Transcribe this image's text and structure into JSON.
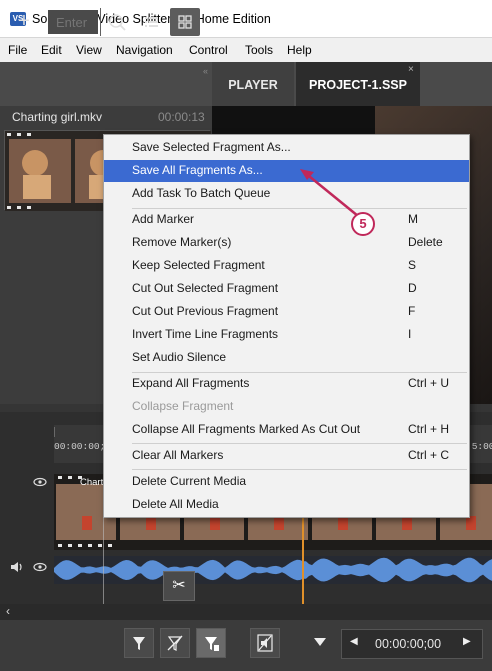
{
  "window": {
    "title": "SolveigMM Video Splitter 8.0 Home Edition",
    "icon_text": "VS"
  },
  "menubar": {
    "items": [
      "File",
      "Edit",
      "View",
      "Navigation",
      "Control",
      "Tools",
      "Help"
    ]
  },
  "toolbar": {
    "search_placeholder": "Enter",
    "add_icon": "plus-icon",
    "search_icon": "search-icon",
    "list_icon": "list-icon",
    "grid_icon": "grid-icon"
  },
  "tabs": {
    "player": "PLAYER",
    "project": "PROJECT-1.SSP",
    "close_glyph": "×"
  },
  "media": {
    "filename": "Charting girl.mkv",
    "duration": "00:00:13"
  },
  "timeline": {
    "ticks": [
      "00:00:00;00",
      ";5:00"
    ],
    "clip_label": "Chart"
  },
  "bottombar": {
    "time": "00:00:00;00"
  },
  "context_menu": {
    "items": [
      {
        "label": "Save Selected Fragment As...",
        "shortcut": ""
      },
      {
        "label": "Save All Fragments As...",
        "shortcut": "",
        "highlighted": true
      },
      {
        "label": "Add Task To Batch Queue",
        "shortcut": ""
      },
      {
        "label": "Add Marker",
        "shortcut": "M"
      },
      {
        "label": "Remove Marker(s)",
        "shortcut": "Delete"
      },
      {
        "label": "Keep Selected Fragment",
        "shortcut": "S"
      },
      {
        "label": "Cut Out Selected Fragment",
        "shortcut": "D"
      },
      {
        "label": "Cut Out Previous Fragment",
        "shortcut": "F"
      },
      {
        "label": "Invert Time Line Fragments",
        "shortcut": "I"
      },
      {
        "label": "Set Audio Silence",
        "shortcut": ""
      },
      {
        "label": "Expand All Fragments",
        "shortcut": "Ctrl + U"
      },
      {
        "label": "Collapse Fragment",
        "shortcut": "",
        "disabled": true
      },
      {
        "label": "Collapse All Fragments Marked As Cut Out",
        "shortcut": "Ctrl + H"
      },
      {
        "label": "Clear All Markers",
        "shortcut": "Ctrl + C"
      },
      {
        "label": "Delete Current Media",
        "shortcut": ""
      },
      {
        "label": "Delete All Media",
        "shortcut": ""
      }
    ]
  },
  "annotation": {
    "step": "5"
  },
  "colors": {
    "highlight": "#3b6ad1",
    "annotation": "#c0285a",
    "playhead": "#e0902a",
    "waveform": "#5b8fd6"
  }
}
